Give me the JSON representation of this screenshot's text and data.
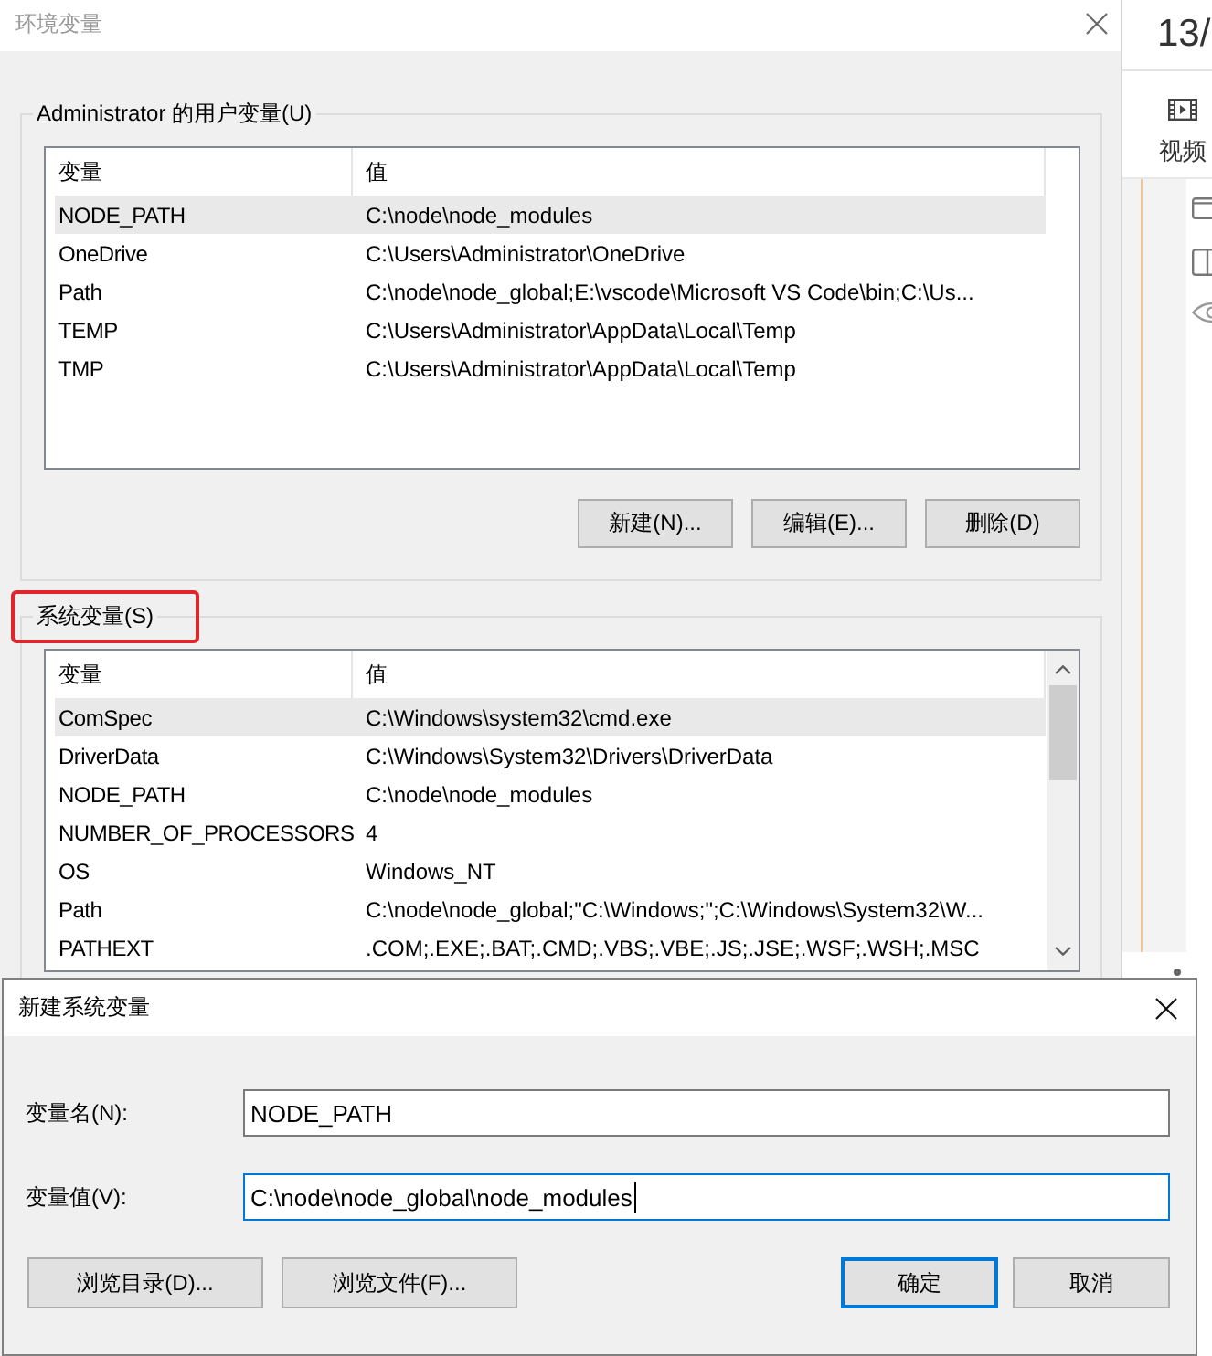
{
  "window": {
    "title": "环境变量"
  },
  "user_variables": {
    "label": "Administrator 的用户变量(U)",
    "columns": [
      "变量",
      "值"
    ],
    "rows": [
      {
        "name": "NODE_PATH",
        "value": "C:\\node\\node_modules",
        "selected": true
      },
      {
        "name": "OneDrive",
        "value": "C:\\Users\\Administrator\\OneDrive",
        "selected": false
      },
      {
        "name": "Path",
        "value": "C:\\node\\node_global;E:\\vscode\\Microsoft VS Code\\bin;C:\\Us...",
        "selected": false
      },
      {
        "name": "TEMP",
        "value": "C:\\Users\\Administrator\\AppData\\Local\\Temp",
        "selected": false
      },
      {
        "name": "TMP",
        "value": "C:\\Users\\Administrator\\AppData\\Local\\Temp",
        "selected": false
      }
    ],
    "buttons": [
      "新建(N)...",
      "编辑(E)...",
      "删除(D)"
    ]
  },
  "system_variables": {
    "label": "系统变量(S)",
    "highlighted": true,
    "columns": [
      "变量",
      "值"
    ],
    "rows": [
      {
        "name": "ComSpec",
        "value": "C:\\Windows\\system32\\cmd.exe",
        "selected": true
      },
      {
        "name": "DriverData",
        "value": "C:\\Windows\\System32\\Drivers\\DriverData",
        "selected": false
      },
      {
        "name": "NODE_PATH",
        "value": "C:\\node\\node_modules",
        "selected": false
      },
      {
        "name": "NUMBER_OF_PROCESSORS",
        "value": "4",
        "selected": false
      },
      {
        "name": "OS",
        "value": "Windows_NT",
        "selected": false
      },
      {
        "name": "Path",
        "value": "C:\\node\\node_global;\"C:\\Windows;\";C:\\Windows\\System32\\W...",
        "selected": false
      },
      {
        "name": "PATHEXT",
        "value": ".COM;.EXE;.BAT;.CMD;.VBS;.VBE;.JS;.JSE;.WSF;.WSH;.MSC",
        "selected": false
      }
    ]
  },
  "dialog": {
    "title": "新建系统变量",
    "fields": [
      {
        "label": "变量名(N):",
        "value": "NODE_PATH",
        "focused": false
      },
      {
        "label": "变量值(V):",
        "value": "C:\\node\\node_global\\node_modules",
        "focused": true
      }
    ],
    "browse_buttons": [
      "浏览目录(D)...",
      "浏览文件(F)..."
    ],
    "buttons": [
      {
        "label": "确定",
        "default": true
      },
      {
        "label": "取消",
        "default": false
      }
    ]
  },
  "side_panel": {
    "page": "13/",
    "tab": "视频"
  }
}
